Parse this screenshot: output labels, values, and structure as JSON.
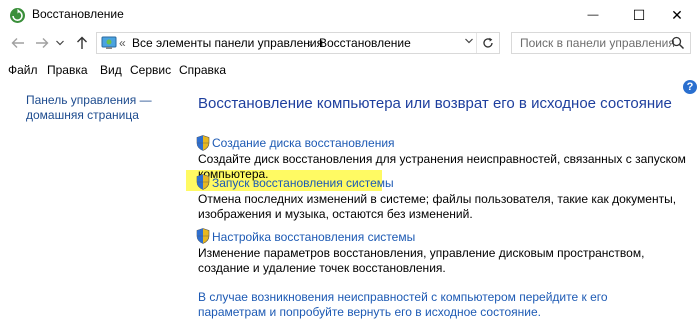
{
  "window": {
    "title": "Восстановление",
    "controls": {
      "minimize": "—",
      "maximize": "☐",
      "close": "✕"
    }
  },
  "nav": {
    "back_icon": "arrow-left-icon",
    "forward_icon": "arrow-right-icon",
    "recent_icon": "chevron-down-icon",
    "up_icon": "arrow-up-icon"
  },
  "address": {
    "overflow": "«",
    "crumbs": [
      "Все элементы панели управления",
      "Восстановление"
    ],
    "separator": "›"
  },
  "search": {
    "placeholder": "Поиск в панели управления"
  },
  "menu": [
    "Файл",
    "Правка",
    "Вид",
    "Сервис",
    "Справка"
  ],
  "help_label": "?",
  "sidebar": {
    "home_link": "Панель управления — домашняя страница"
  },
  "main": {
    "title": "Восстановление компьютера или возврат его в исходное состояние",
    "items": [
      {
        "link": "Создание диска восстановления",
        "description": "Создайте диск восстановления для устранения неисправностей, связанных с запуском компьютера."
      },
      {
        "link": "Запуск восстановления системы",
        "description": "Отмена последних изменений в системе; файлы пользователя, такие как документы, изображения и музыка, остаются без изменений."
      },
      {
        "link": "Настройка восстановления системы",
        "description": "Изменение параметров восстановления, управление дисковым пространством, создание и удаление точек восстановления."
      }
    ],
    "bottom_link": "В случае возникновения неисправностей с компьютером перейдите к его параметрам и попробуйте вернуть его в исходное состояние."
  },
  "colors": {
    "highlight": "#fffa63",
    "link": "#1d5ab4",
    "title": "#1e3f9e"
  }
}
